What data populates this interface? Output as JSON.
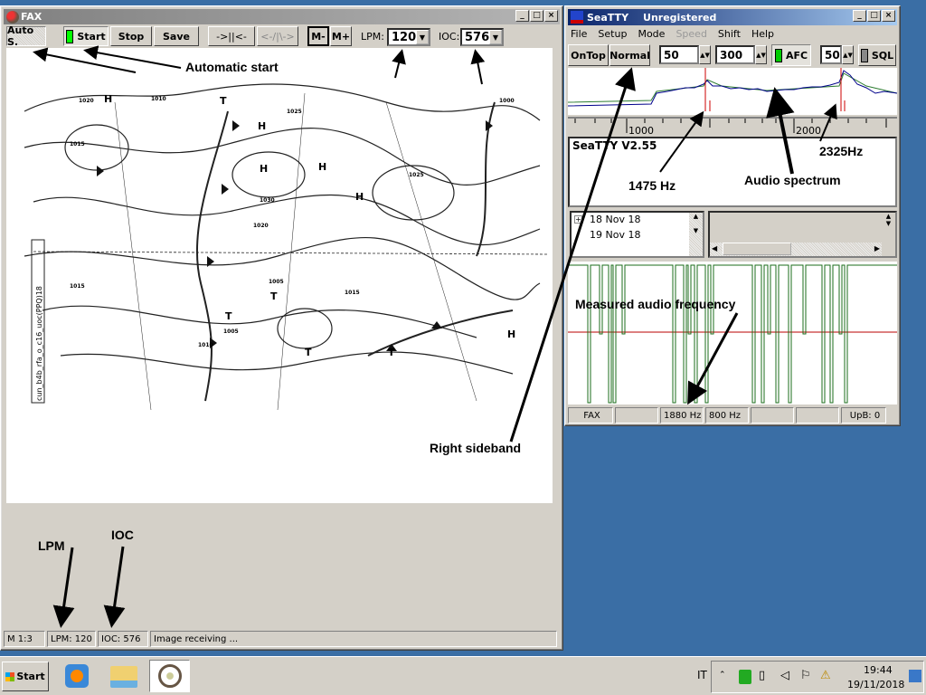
{
  "fax": {
    "title": "FAX",
    "toolbar": {
      "auto_start": "Auto S.",
      "start": "Start",
      "stop": "Stop",
      "save": "Save",
      "center": "->||<-",
      "spread": "<-/|\\->",
      "m_minus": "M-",
      "m_plus": "M+",
      "lpm_label": "LPM:",
      "lpm_value": "120",
      "ioc_label": "IOC:",
      "ioc_value": "576"
    },
    "map_labels": [
      "H",
      "H",
      "H",
      "H",
      "H",
      "H",
      "T",
      "T",
      "T",
      "T",
      "T",
      "1020",
      "1015",
      "1010",
      "1025",
      "1030",
      "1005",
      "1000",
      "1015",
      "1020",
      "1025",
      "1010",
      "1005",
      "1015"
    ],
    "map_side_text": "cun_b4b_rfa_o_c16_uoc(PPQ)18",
    "status": [
      "M 1:3",
      "LPM: 120",
      "IOC: 576",
      "Image receiving ..."
    ]
  },
  "seatty": {
    "title": "SeaTTY",
    "title_status": "Unregistered",
    "menu": [
      "File",
      "Setup",
      "Mode",
      "Speed",
      "Shift",
      "Help"
    ],
    "toolbar": {
      "ontop": "OnTop",
      "normal": "Normal",
      "value1": "50",
      "value2": "300",
      "afc": "AFC",
      "value3": "50",
      "sql": "SQL"
    },
    "ruler": [
      "1000",
      "2000"
    ],
    "text_area": "SeaTTY V2.55",
    "dates": [
      "18 Nov 18",
      "19 Nov 18"
    ],
    "status": [
      "FAX",
      "",
      "1880 Hz",
      "800 Hz",
      "",
      "",
      "UpB: 0"
    ],
    "colors": {
      "spectrum": "#00008b",
      "spectrum_avg": "#2e7d32",
      "marker": "#cc0000",
      "freq_trace": "#1b6e1b"
    }
  },
  "annotations": {
    "automatic_start": "Automatic start",
    "right_sideband": "Right sideband",
    "hz1475": "1475 Hz",
    "audio_spectrum": "Audio spectrum",
    "hz2325": "2325Hz",
    "measured_freq": "Measured audio frequency",
    "lpm": "LPM",
    "ioc": "IOC"
  },
  "taskbar": {
    "start": "Start",
    "language": "IT",
    "time": "19:44",
    "date": "19/11/2018"
  }
}
